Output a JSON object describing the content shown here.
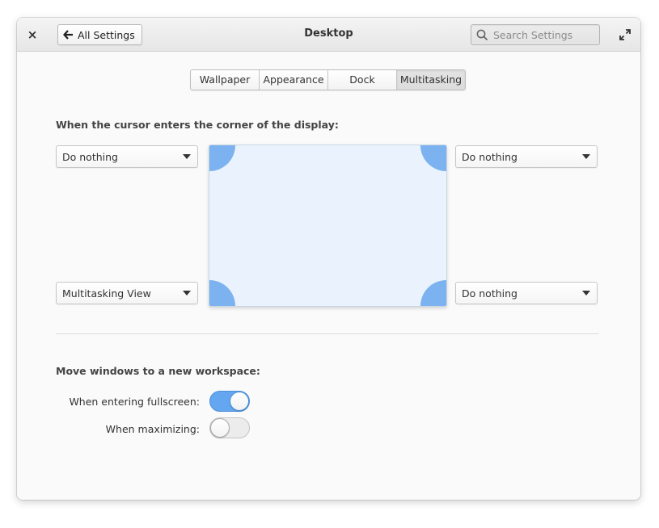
{
  "header": {
    "close_glyph": "×",
    "back_label": "All Settings",
    "title": "Desktop",
    "search_placeholder": "Search Settings"
  },
  "tabs": [
    {
      "label": "Wallpaper",
      "active": false
    },
    {
      "label": "Appearance",
      "active": false
    },
    {
      "label": "Dock",
      "active": false
    },
    {
      "label": "Multitasking",
      "active": true
    }
  ],
  "hot_corners": {
    "section_label": "When the cursor enters the corner of the display:",
    "top_left": "Do nothing",
    "top_right": "Do nothing",
    "bottom_left": "Multitasking View",
    "bottom_right": "Do nothing"
  },
  "workspaces": {
    "section_label": "Move windows to a new workspace:",
    "fullscreen": {
      "label": "When entering fullscreen:",
      "on": true
    },
    "maximizing": {
      "label": "When maximizing:",
      "on": false
    }
  },
  "colors": {
    "accent": "#64a7f0",
    "hot_corner": "#7cb2ef",
    "preview_bg": "#eaf3fd"
  }
}
